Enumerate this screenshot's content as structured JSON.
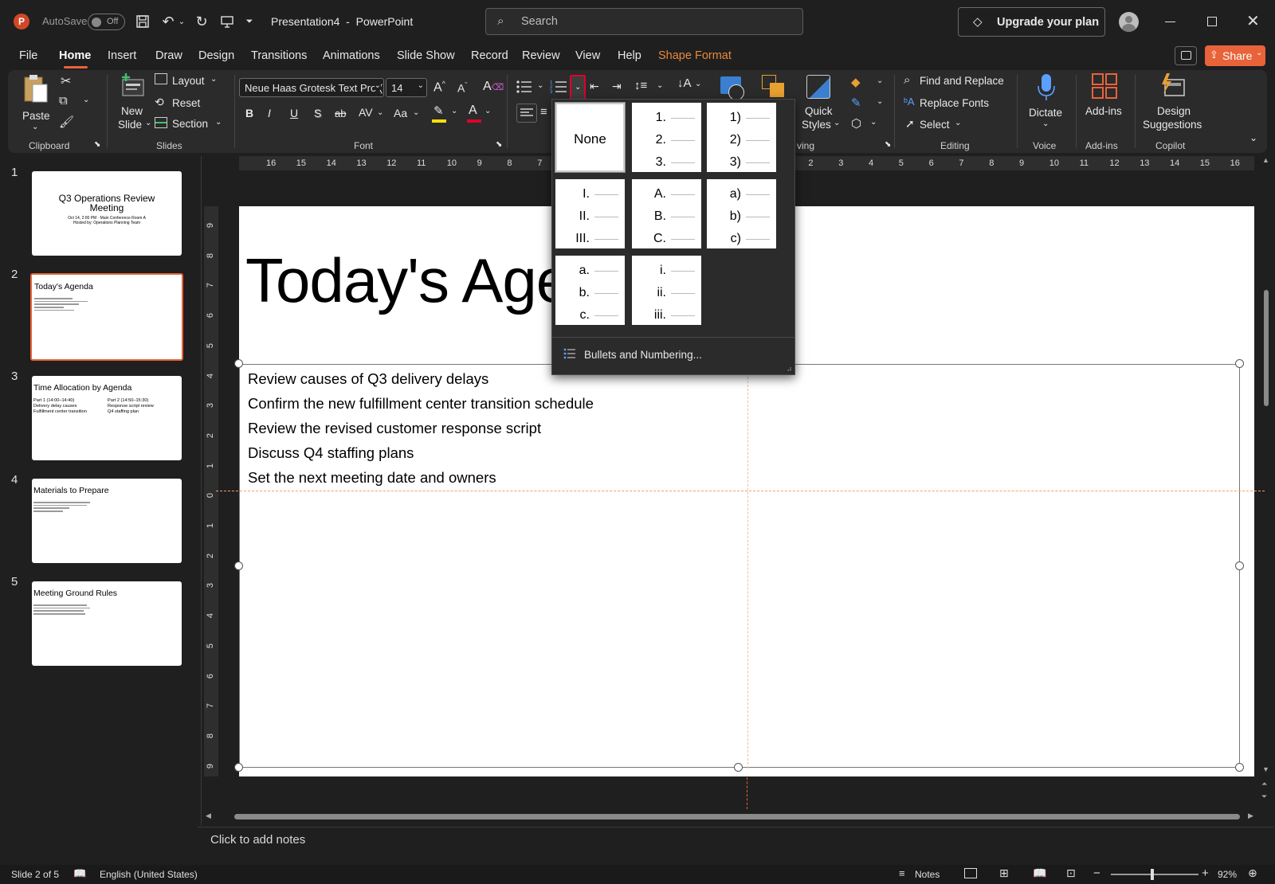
{
  "titlebar": {
    "autosave_label": "AutoSave",
    "autosave_state": "Off",
    "doc_title": "Presentation4  -  PowerPoint",
    "search_placeholder": "Search",
    "upgrade_label": "Upgrade your plan"
  },
  "menu": {
    "tabs": [
      "File",
      "Home",
      "Insert",
      "Draw",
      "Design",
      "Transitions",
      "Animations",
      "Slide Show",
      "Record",
      "Review",
      "View",
      "Help",
      "Shape Format"
    ],
    "active": "Home",
    "share_label": "Share"
  },
  "ribbon": {
    "clipboard": {
      "paste": "Paste",
      "label": "Clipboard"
    },
    "slides": {
      "new_slide_1": "New",
      "new_slide_2": "Slide",
      "layout": "Layout",
      "reset": "Reset",
      "section": "Section",
      "label": "Slides"
    },
    "font": {
      "family": "Neue Haas Grotesk Text Pro (B",
      "size": "14",
      "bold": "B",
      "italic": "I",
      "underline": "U",
      "shadow": "S",
      "strike": "ab",
      "spacing": "AV",
      "case": "Aa",
      "label": "Font"
    },
    "drawing": {
      "quick_styles_1": "Quick",
      "quick_styles_2": "Styles",
      "label_partial": "ving"
    },
    "editing": {
      "find_replace": "Find and Replace",
      "replace_fonts": "Replace Fonts",
      "select": "Select",
      "label": "Editing"
    },
    "voice": {
      "dictate": "Dictate",
      "label": "Voice"
    },
    "addins": {
      "addins": "Add-ins",
      "label": "Add-ins"
    },
    "copilot": {
      "design_1": "Design",
      "design_2": "Suggestions",
      "label": "Copilot"
    }
  },
  "numbering_dropdown": {
    "none_label": "None",
    "options": [
      [
        "1.",
        "2.",
        "3."
      ],
      [
        "1)",
        "2)",
        "3)"
      ],
      [
        "I.",
        "II.",
        "III."
      ],
      [
        "A.",
        "B.",
        "C."
      ],
      [
        "a)",
        "b)",
        "c)"
      ],
      [
        "a.",
        "b.",
        "c."
      ],
      [
        "i.",
        "ii.",
        "iii."
      ]
    ],
    "footer": "Bullets and Numbering..."
  },
  "ruler": {
    "h_ticks": [
      "16",
      "15",
      "14",
      "13",
      "12",
      "11",
      "10",
      "9",
      "8",
      "7",
      "6",
      "5",
      "4",
      "3",
      "2",
      "1",
      "0",
      "1",
      "2",
      "3",
      "4",
      "5",
      "6",
      "7",
      "8",
      "9",
      "10",
      "11",
      "12",
      "13",
      "14",
      "15",
      "16"
    ],
    "v_ticks": [
      "9",
      "8",
      "7",
      "6",
      "5",
      "4",
      "3",
      "2",
      "1",
      "0",
      "1",
      "2",
      "3",
      "4",
      "5",
      "6",
      "7",
      "8",
      "9"
    ]
  },
  "thumbnails": [
    {
      "num": "1",
      "title": "Q3 Operations Review Meeting",
      "sub1": "Oct 14, 2:00 PM · Main Conference Room A",
      "sub2": "Hosted by: Operations Planning Team"
    },
    {
      "num": "2",
      "title": "Today's Agenda",
      "lines": 5
    },
    {
      "num": "3",
      "title": "Time Allocation by Agenda",
      "c1": [
        "Part 1 (14:00–14:40)",
        "Delivery delay causes",
        "Fulfillment center transition"
      ],
      "c2": [
        "Part 2 (14:50–15:30)",
        "Response script review",
        "Q4 staffing plan"
      ]
    },
    {
      "num": "4",
      "title": "Materials to Prepare",
      "lines": 4
    },
    {
      "num": "5",
      "title": "Meeting Ground Rules",
      "lines": 4
    }
  ],
  "slide": {
    "title": "Today's Age",
    "bullets": [
      "Review causes of Q3 delivery delays",
      "Confirm the new fulfillment center transition schedule",
      "Review the revised customer response script",
      "Discuss Q4 staffing plans",
      "Set the next meeting date and owners"
    ]
  },
  "notes_placeholder": "Click to add notes",
  "status": {
    "slide_info": "Slide 2 of 5",
    "language": "English (United States)",
    "notes": "Notes",
    "zoom": "92%"
  },
  "colors": {
    "accent": "#e8633a",
    "shape_format": "#e8893a",
    "selection_red": "#e0002a"
  }
}
